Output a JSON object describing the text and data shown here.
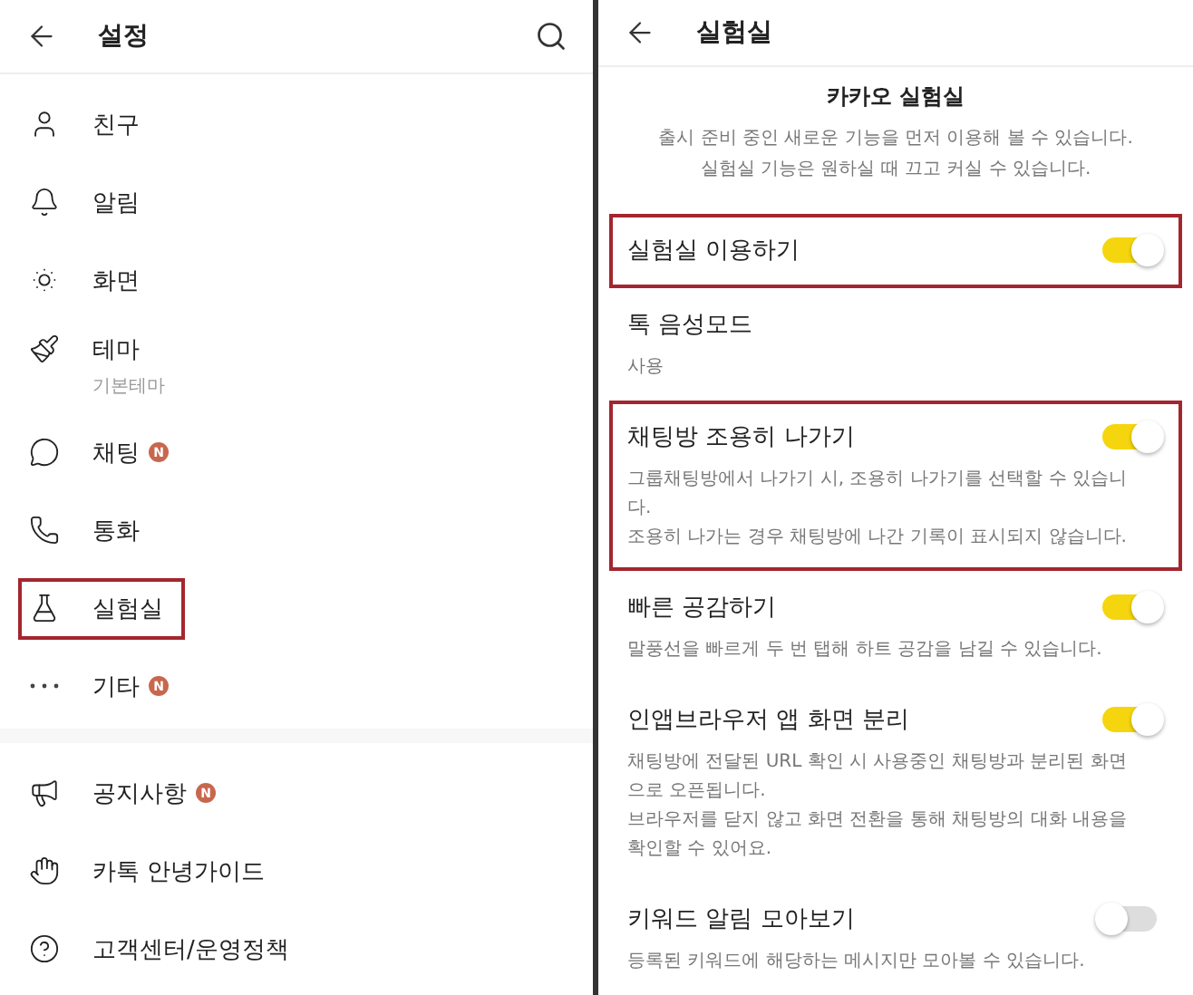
{
  "settings_panel": {
    "title": "설정",
    "sections": [
      {
        "items": [
          {
            "label": "친구",
            "highlighted": false
          },
          {
            "label": "알림",
            "highlighted": false
          },
          {
            "label": "화면",
            "highlighted": false
          },
          {
            "label": "테마",
            "sublabel": "기본테마",
            "highlighted": false
          },
          {
            "label": "채팅",
            "badge": "N",
            "highlighted": false
          },
          {
            "label": "통화",
            "highlighted": false
          },
          {
            "label": "실험실",
            "highlighted": true
          },
          {
            "label": "기타",
            "badge": "N",
            "highlighted": false
          }
        ]
      },
      {
        "items": [
          {
            "label": "공지사항",
            "badge": "N",
            "highlighted": false
          },
          {
            "label": "카톡 안녕가이드",
            "highlighted": false
          },
          {
            "label": "고객센터/운영정책",
            "highlighted": false
          }
        ]
      }
    ]
  },
  "lab_panel": {
    "title": "실험실",
    "intro": {
      "heading": "카카오 실험실",
      "lines": [
        "출시 준비 중인 새로운 기능을 먼저 이용해 볼 수 있습니다.",
        "실험실 기능은 원하실 때 끄고 커실 수 있습니다."
      ]
    },
    "settings": [
      {
        "kind": "toggle",
        "label": "실험실 이용하기",
        "on": true,
        "highlighted": true
      },
      {
        "kind": "value",
        "label": "톡 음성모드",
        "value": "사용",
        "highlighted": false
      },
      {
        "kind": "toggle",
        "label": "채팅방 조용히 나가기",
        "on": true,
        "highlighted": true,
        "description": [
          "그룹채팅방에서 나가기 시, 조용히 나가기를 선택할 수 있습니다.",
          "조용히 나가는 경우 채팅방에 나간 기록이 표시되지 않습니다."
        ]
      },
      {
        "kind": "toggle",
        "label": "빠른 공감하기",
        "on": true,
        "highlighted": false,
        "description": [
          "말풍선을 빠르게 두 번 탭해 하트 공감을 남길 수 있습니다."
        ]
      },
      {
        "kind": "toggle",
        "label": "인앱브라우저 앱 화면 분리",
        "on": true,
        "highlighted": false,
        "description": [
          "채팅방에 전달된 URL 확인 시 사용중인 채팅방과 분리된 화면으로 오픈됩니다.",
          "브라우저를 닫지 않고 화면 전환을 통해 채팅방의 대화 내용을 확인할 수 있어요."
        ]
      },
      {
        "kind": "toggle",
        "label": "키워드 알림 모아보기",
        "on": false,
        "highlighted": false,
        "description": [
          "등록된 키워드에 해당하는 메시지만 모아볼 수 있습니다."
        ]
      }
    ]
  }
}
